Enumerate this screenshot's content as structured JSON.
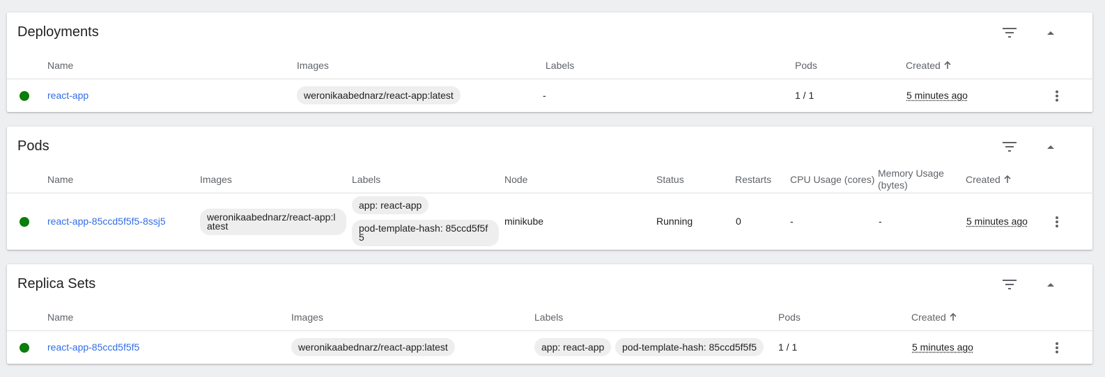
{
  "deployments": {
    "title": "Deployments",
    "columns": {
      "name": "Name",
      "images": "Images",
      "labels": "Labels",
      "pods": "Pods",
      "created": "Created"
    },
    "rows": [
      {
        "name": "react-app",
        "image": "weronikaabednarz/react-app:latest",
        "labels": "-",
        "pods": "1 / 1",
        "created": "5 minutes ago"
      }
    ]
  },
  "pods": {
    "title": "Pods",
    "columns": {
      "name": "Name",
      "images": "Images",
      "labels": "Labels",
      "node": "Node",
      "status": "Status",
      "restarts": "Restarts",
      "cpu": "CPU Usage (cores)",
      "memory": "Memory Usage (bytes)",
      "created": "Created"
    },
    "rows": [
      {
        "name": "react-app-85ccd5f5f5-8ssj5",
        "image": "weronikaabednarz/react-app:latest",
        "label_1": "app: react-app",
        "label_2": "pod-template-hash: 85ccd5f5f5",
        "node": "minikube",
        "status": "Running",
        "restarts": "0",
        "cpu": "-",
        "memory": "-",
        "created": "5 minutes ago"
      }
    ]
  },
  "replica_sets": {
    "title": "Replica Sets",
    "columns": {
      "name": "Name",
      "images": "Images",
      "labels": "Labels",
      "pods": "Pods",
      "created": "Created"
    },
    "rows": [
      {
        "name": "react-app-85ccd5f5f5",
        "image": "weronikaabednarz/react-app:latest",
        "label_1": "app: react-app",
        "label_2": "pod-template-hash: 85ccd5f5f5",
        "pods": "1 / 1",
        "created": "5 minutes ago"
      }
    ]
  },
  "colors": {
    "status_ok": "#0a7d0a",
    "link": "#326de6",
    "background": "#eeeff0"
  }
}
